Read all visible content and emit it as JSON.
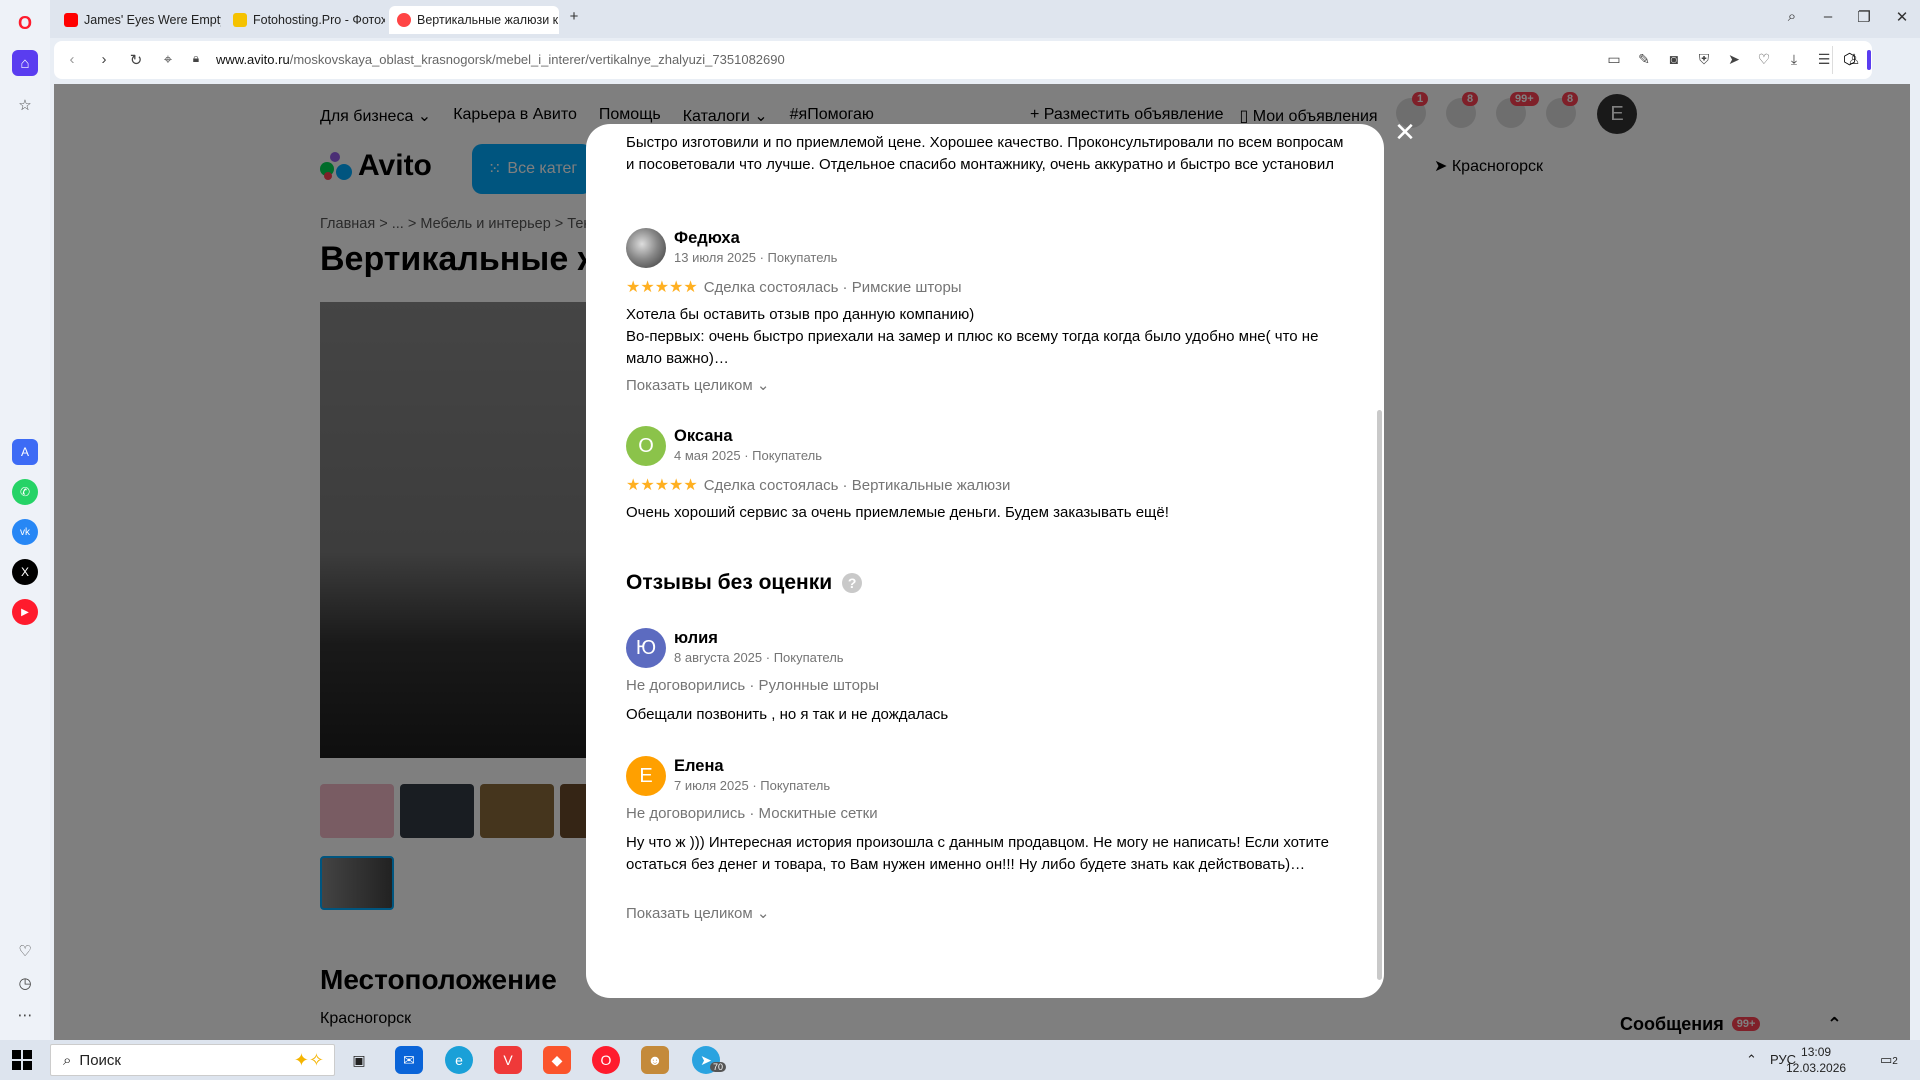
{
  "browser": {
    "tabs": [
      {
        "title": "James' Eyes Were Empty"
      },
      {
        "title": "Fotohosting.Pro - Фотохо"
      },
      {
        "title": "Вертикальные жалюзи к"
      }
    ],
    "url_host": "www.avito.ru",
    "url_path": "/moskovskaya_oblast_krasnogorsk/mebel_i_interer/vertikalnye_zhalyuzi_7351082690",
    "icons": [
      "opera-icon",
      "search-icon",
      "minimize-icon",
      "restore-icon",
      "close-icon"
    ]
  },
  "page": {
    "nav": [
      "Для бизнеса ⌄",
      "Карьера в Авито",
      "Помощь",
      "Каталоги ⌄",
      "#яПомогаю"
    ],
    "post_ad": "+ Разместить объявление",
    "my_ads": "Мои объявления",
    "badges": {
      "favorites": "1",
      "notifications": "8",
      "messages": "99+",
      "cart": "8"
    },
    "avatar_letter": "Е",
    "logo": "Avito",
    "categories_btn": "Все катег",
    "location_top": "Красногорск",
    "breadcrumbs": "Главная  >  ...  >  Мебель и интерьер  >  Тек",
    "title": "Вертикальные ж",
    "location_heading": "Местоположение",
    "location_text": "Красногорск",
    "messages_panel": "Сообщения",
    "messages_badge": "99+"
  },
  "modal": {
    "top_text": "Быстро изготовили и по приемлемой цене. Хорошее качество. Проконсультировали по всем вопросам и посоветовали что лучше. Отдельное спасибо монтажнику, очень аккуратно и быстро все установил",
    "reviews": [
      {
        "name": "Федюха",
        "meta": "13 июля 2025 · Покупатель",
        "stars": "★★★★★",
        "line": "Сделка состоялась · Римские шторы",
        "body": "Хотела бы оставить отзыв про данную компанию)\nВо-первых: очень быстро приехали на замер и плюс ко всему тогда когда было удобно мне( что не мало важно)…",
        "more": "Показать целиком ⌄"
      },
      {
        "name": "Оксана",
        "avatar": "О",
        "meta": "4 мая 2025 · Покупатель",
        "stars": "★★★★★",
        "line": "Сделка состоялась · Вертикальные жалюзи",
        "body": "Очень хороший сервис за очень приемлемые деньги. Будем заказывать ещё!"
      }
    ],
    "no_rating_title": "Отзывы без оценки",
    "help": "?",
    "unrated": [
      {
        "name": "юлия",
        "avatar": "Ю",
        "meta": "8 августа 2025 · Покупатель",
        "line": "Не договорились · Рулонные шторы",
        "body": "Обещали позвонить , но я так и не дождалась"
      },
      {
        "name": "Елена",
        "avatar": "Е",
        "meta": "7 июля 2025 · Покупатель",
        "line": "Не договорились · Москитные сетки",
        "body": "Ну что ж ))) Интересная история произошла с данным продавцом. Не могу не написать! Если хотите остаться без денег и товара, то Вам нужен именно он!!! Ну либо будете знать как действовать)…",
        "more": "Показать целиком ⌄"
      }
    ]
  },
  "taskbar": {
    "search": "Поиск",
    "lang": "РУС",
    "time": "13:09",
    "date": "12.03.2026",
    "notif_count": "2",
    "telegram_badge": "70"
  }
}
